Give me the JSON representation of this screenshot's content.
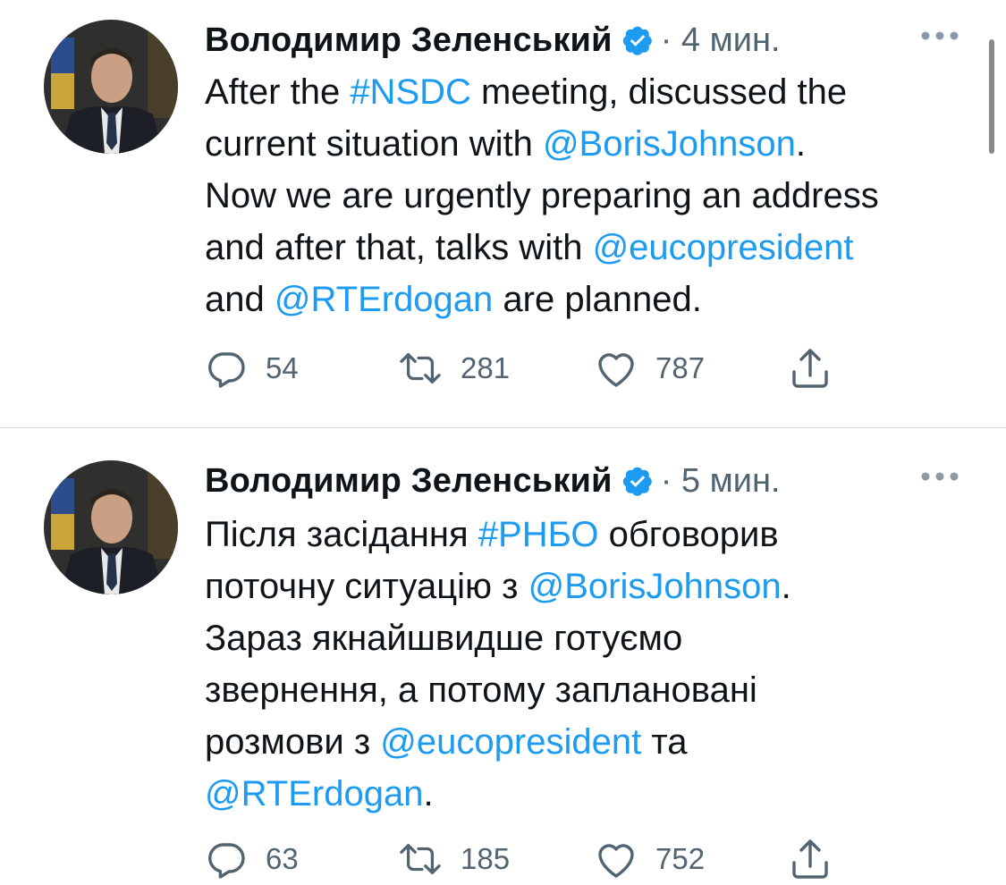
{
  "tweets": [
    {
      "author": "Володимир Зеленський",
      "time": "· 4 мин.",
      "lines": [
        [
          {
            "t": "After the ",
            "link": false
          },
          {
            "t": "#NSDC",
            "link": true
          },
          {
            "t": " meeting, discussed the",
            "link": false
          }
        ],
        [
          {
            "t": "current situation with ",
            "link": false
          },
          {
            "t": "@BorisJohnson",
            "link": true
          },
          {
            "t": ".",
            "link": false
          }
        ],
        [
          {
            "t": "Now we are urgently preparing an address",
            "link": false
          }
        ],
        [
          {
            "t": "and after that, talks with ",
            "link": false
          },
          {
            "t": "@eucopresident",
            "link": true
          }
        ],
        [
          {
            "t": "and ",
            "link": false
          },
          {
            "t": "@RTErdogan",
            "link": true
          },
          {
            "t": " are planned.",
            "link": false
          }
        ]
      ],
      "replies": "54",
      "retweets": "281",
      "likes": "787"
    },
    {
      "author": "Володимир Зеленський",
      "time": "· 5 мин.",
      "lines": [
        [
          {
            "t": "Після засідання ",
            "link": false
          },
          {
            "t": "#РНБО",
            "link": true
          },
          {
            "t": " обговорив",
            "link": false
          }
        ],
        [
          {
            "t": "поточну ситуацію з ",
            "link": false
          },
          {
            "t": "@BorisJohnson",
            "link": true
          },
          {
            "t": ".",
            "link": false
          }
        ],
        [
          {
            "t": "Зараз якнайшвидше готуємо",
            "link": false
          }
        ],
        [
          {
            "t": "звернення, а потому заплановані",
            "link": false
          }
        ],
        [
          {
            "t": "розмови з ",
            "link": false
          },
          {
            "t": "@eucopresident",
            "link": true
          },
          {
            "t": " та",
            "link": false
          }
        ],
        [
          {
            "t": "@RTErdogan",
            "link": true
          },
          {
            "t": ".",
            "link": false
          }
        ]
      ],
      "replies": "63",
      "retweets": "185",
      "likes": "752"
    }
  ],
  "icons": {
    "verified": "verified-badge-icon",
    "more": "more-dots-icon",
    "reply": "reply-icon",
    "retweet": "retweet-icon",
    "like": "heart-icon",
    "share": "share-icon"
  },
  "colors": {
    "link": "#1d9bf0",
    "text": "#0f1419",
    "secondary": "#536471",
    "divider": "#cfd9de"
  }
}
